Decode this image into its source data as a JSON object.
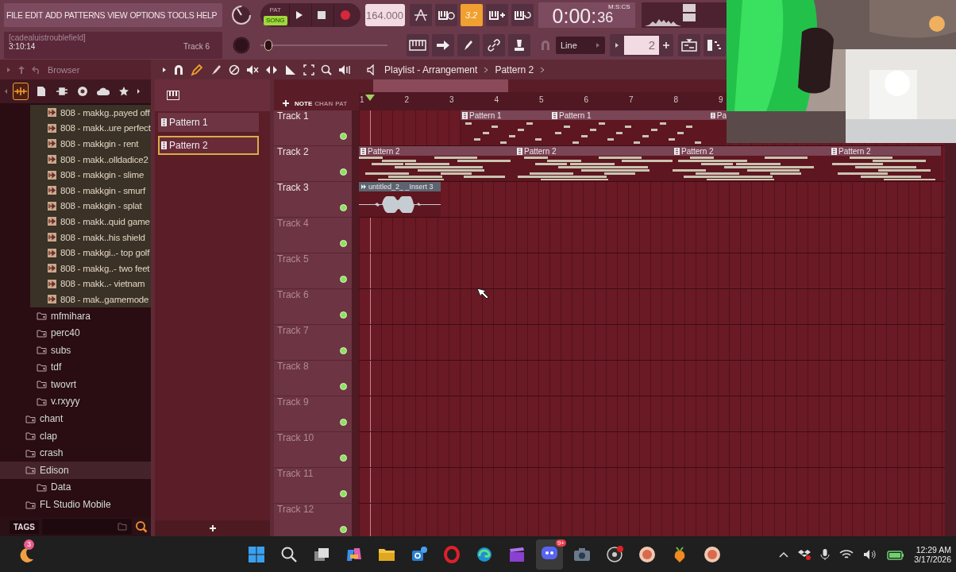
{
  "menu": [
    "FILE",
    "EDIT",
    "ADD",
    "PATTERNS",
    "VIEW",
    "OPTIONS",
    "TOOLS",
    "HELP"
  ],
  "transport": {
    "modes": [
      {
        "label": "PAT",
        "selected": false
      },
      {
        "label": "SONG",
        "selected": true
      }
    ],
    "tempo": "164.000",
    "snap_indicator": "3.2",
    "time": "0:00:",
    "time_seconds": "36",
    "time_format": "M:S:CS"
  },
  "hint_bar": {
    "title": "[cadealuistroublefield]",
    "time": "3:10:14",
    "track": "Track 6"
  },
  "master_pitch": {
    "level": 0.03
  },
  "snap": {
    "value": "Line"
  },
  "pattern_selector": {
    "value": "2"
  },
  "browser": {
    "title": "Browser",
    "tabs": [
      {
        "kind": "audio",
        "selected": true
      },
      {
        "kind": "files",
        "selected": false
      },
      {
        "kind": "plugins",
        "selected": false
      },
      {
        "kind": "online",
        "selected": false
      },
      {
        "kind": "cloud",
        "selected": false
      },
      {
        "kind": "favorites",
        "selected": false
      }
    ],
    "tree": [
      {
        "kind": "group",
        "children": [
          {
            "kind": "group",
            "children": [
              {
                "kind": "file",
                "name": "808 - makkg..payed off",
                "selected": false
              },
              {
                "kind": "file",
                "name": "808 - makk..ure perfect",
                "selected": false
              },
              {
                "kind": "file",
                "name": "808 - makkgin - rent",
                "selected": false
              },
              {
                "kind": "file",
                "name": "808 - makk..olldadice2",
                "selected": false
              },
              {
                "kind": "file",
                "name": "808 - makkgin - slime",
                "selected": false
              },
              {
                "kind": "file",
                "name": "808 - makkgin - smurf",
                "selected": false
              },
              {
                "kind": "file",
                "name": "808 - makkgin - splat",
                "selected": false
              },
              {
                "kind": "file",
                "name": "808 - makk..quid game",
                "selected": false
              },
              {
                "kind": "file",
                "name": "808 - makk..his shield",
                "selected": false
              },
              {
                "kind": "file",
                "name": "808 - makkgi..- top golf",
                "selected": false
              },
              {
                "kind": "file",
                "name": "808 - makkg..- two feet",
                "selected": false
              },
              {
                "kind": "file",
                "name": "808 - makk..- vietnam",
                "selected": false
              },
              {
                "kind": "file",
                "name": "808 - mak..gamemode",
                "selected": false
              }
            ]
          },
          {
            "kind": "folder",
            "name": "mfmihara",
            "selected": false
          },
          {
            "kind": "folder",
            "name": "perc40",
            "selected": false
          },
          {
            "kind": "folder",
            "name": "subs",
            "selected": false
          },
          {
            "kind": "folder",
            "name": "tdf",
            "selected": false
          },
          {
            "kind": "folder",
            "name": "twovrt",
            "selected": false
          },
          {
            "kind": "folder",
            "name": "v.rxyyy",
            "selected": false
          }
        ]
      },
      {
        "kind": "folder",
        "name": "chant",
        "selected": false
      },
      {
        "kind": "folder",
        "name": "clap",
        "selected": false
      },
      {
        "kind": "folder",
        "name": "crash",
        "selected": false
      },
      {
        "kind": "folder",
        "name": "Edison",
        "selected": true,
        "children": [
          {
            "kind": "folder",
            "name": "Data",
            "selected": false
          }
        ]
      },
      {
        "kind": "folder",
        "name": "FL Studio Mobile",
        "selected": false
      }
    ],
    "tags_label": "TAGS"
  },
  "patterns": [
    {
      "name": "Pattern 1",
      "selected": false
    },
    {
      "name": "Pattern 2",
      "selected": true
    }
  ],
  "playlist": {
    "title": "Playlist - Arrangement",
    "pattern": "Pattern 2",
    "ruler_modes": [
      {
        "label": "NOTE",
        "selected": true
      },
      {
        "label": "CHAN",
        "selected": false
      },
      {
        "label": "PAT",
        "selected": false
      }
    ],
    "bars": [
      "1",
      "2",
      "3",
      "4",
      "5",
      "6",
      "7",
      "8",
      "9"
    ],
    "tracks": [
      {
        "name": "Track 1",
        "clips": [
          {
            "kind": "melody",
            "label": "Pattern 1"
          },
          {
            "kind": "melody",
            "label": "Pattern 1"
          },
          {
            "kind": "melody",
            "label": "Pa"
          }
        ]
      },
      {
        "name": "Track 2",
        "clips": [
          {
            "kind": "chords",
            "label": "Pattern 2"
          },
          {
            "kind": "chords",
            "label": "Pattern 2"
          },
          {
            "kind": "chords",
            "label": "Pattern 2"
          },
          {
            "kind": "chords",
            "label": "Pattern 2"
          }
        ]
      },
      {
        "name": "Track 3",
        "clips": [
          {
            "kind": "audio",
            "label": "untitled_2_ _Insert 3"
          }
        ]
      },
      {
        "name": "Track 4"
      },
      {
        "name": "Track 5"
      },
      {
        "name": "Track 6"
      },
      {
        "name": "Track 7"
      },
      {
        "name": "Track 8"
      },
      {
        "name": "Track 9"
      },
      {
        "name": "Track 10"
      },
      {
        "name": "Track 11"
      },
      {
        "name": "Track 12"
      }
    ]
  },
  "taskbar": {
    "weather_badge": "3",
    "chat_badge": "9+",
    "time": "12:29 AM",
    "date": "3/17/2026"
  }
}
